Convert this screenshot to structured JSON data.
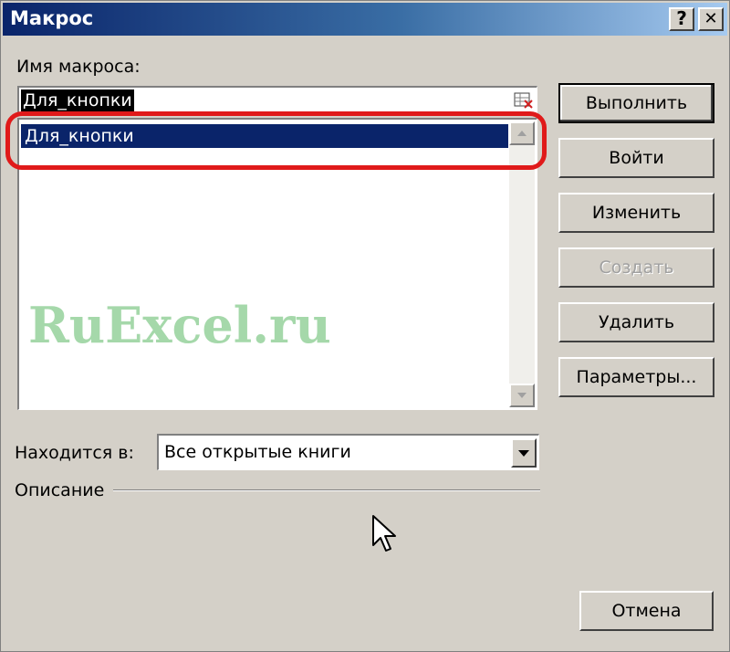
{
  "window": {
    "title": "Макрос",
    "help_button": "?",
    "close_button": "✕"
  },
  "macro_name": {
    "label": "Имя макроса:",
    "value": "Для_кнопки"
  },
  "macro_list": {
    "items": [
      "Для_кнопки"
    ],
    "selected": "Для_кнопки"
  },
  "buttons": {
    "run": "Выполнить",
    "step_into": "Войти",
    "edit": "Изменить",
    "create": "Создать",
    "delete": "Удалить",
    "options": "Параметры...",
    "cancel": "Отмена"
  },
  "location": {
    "label": "Находится в:",
    "value": "Все открытые книги"
  },
  "description": {
    "label": "Описание"
  },
  "watermark": "RuExcel.ru",
  "colors": {
    "highlight_ring": "#e01a1a",
    "selection": "#0a246a",
    "dialog_face": "#d4d0c8"
  }
}
